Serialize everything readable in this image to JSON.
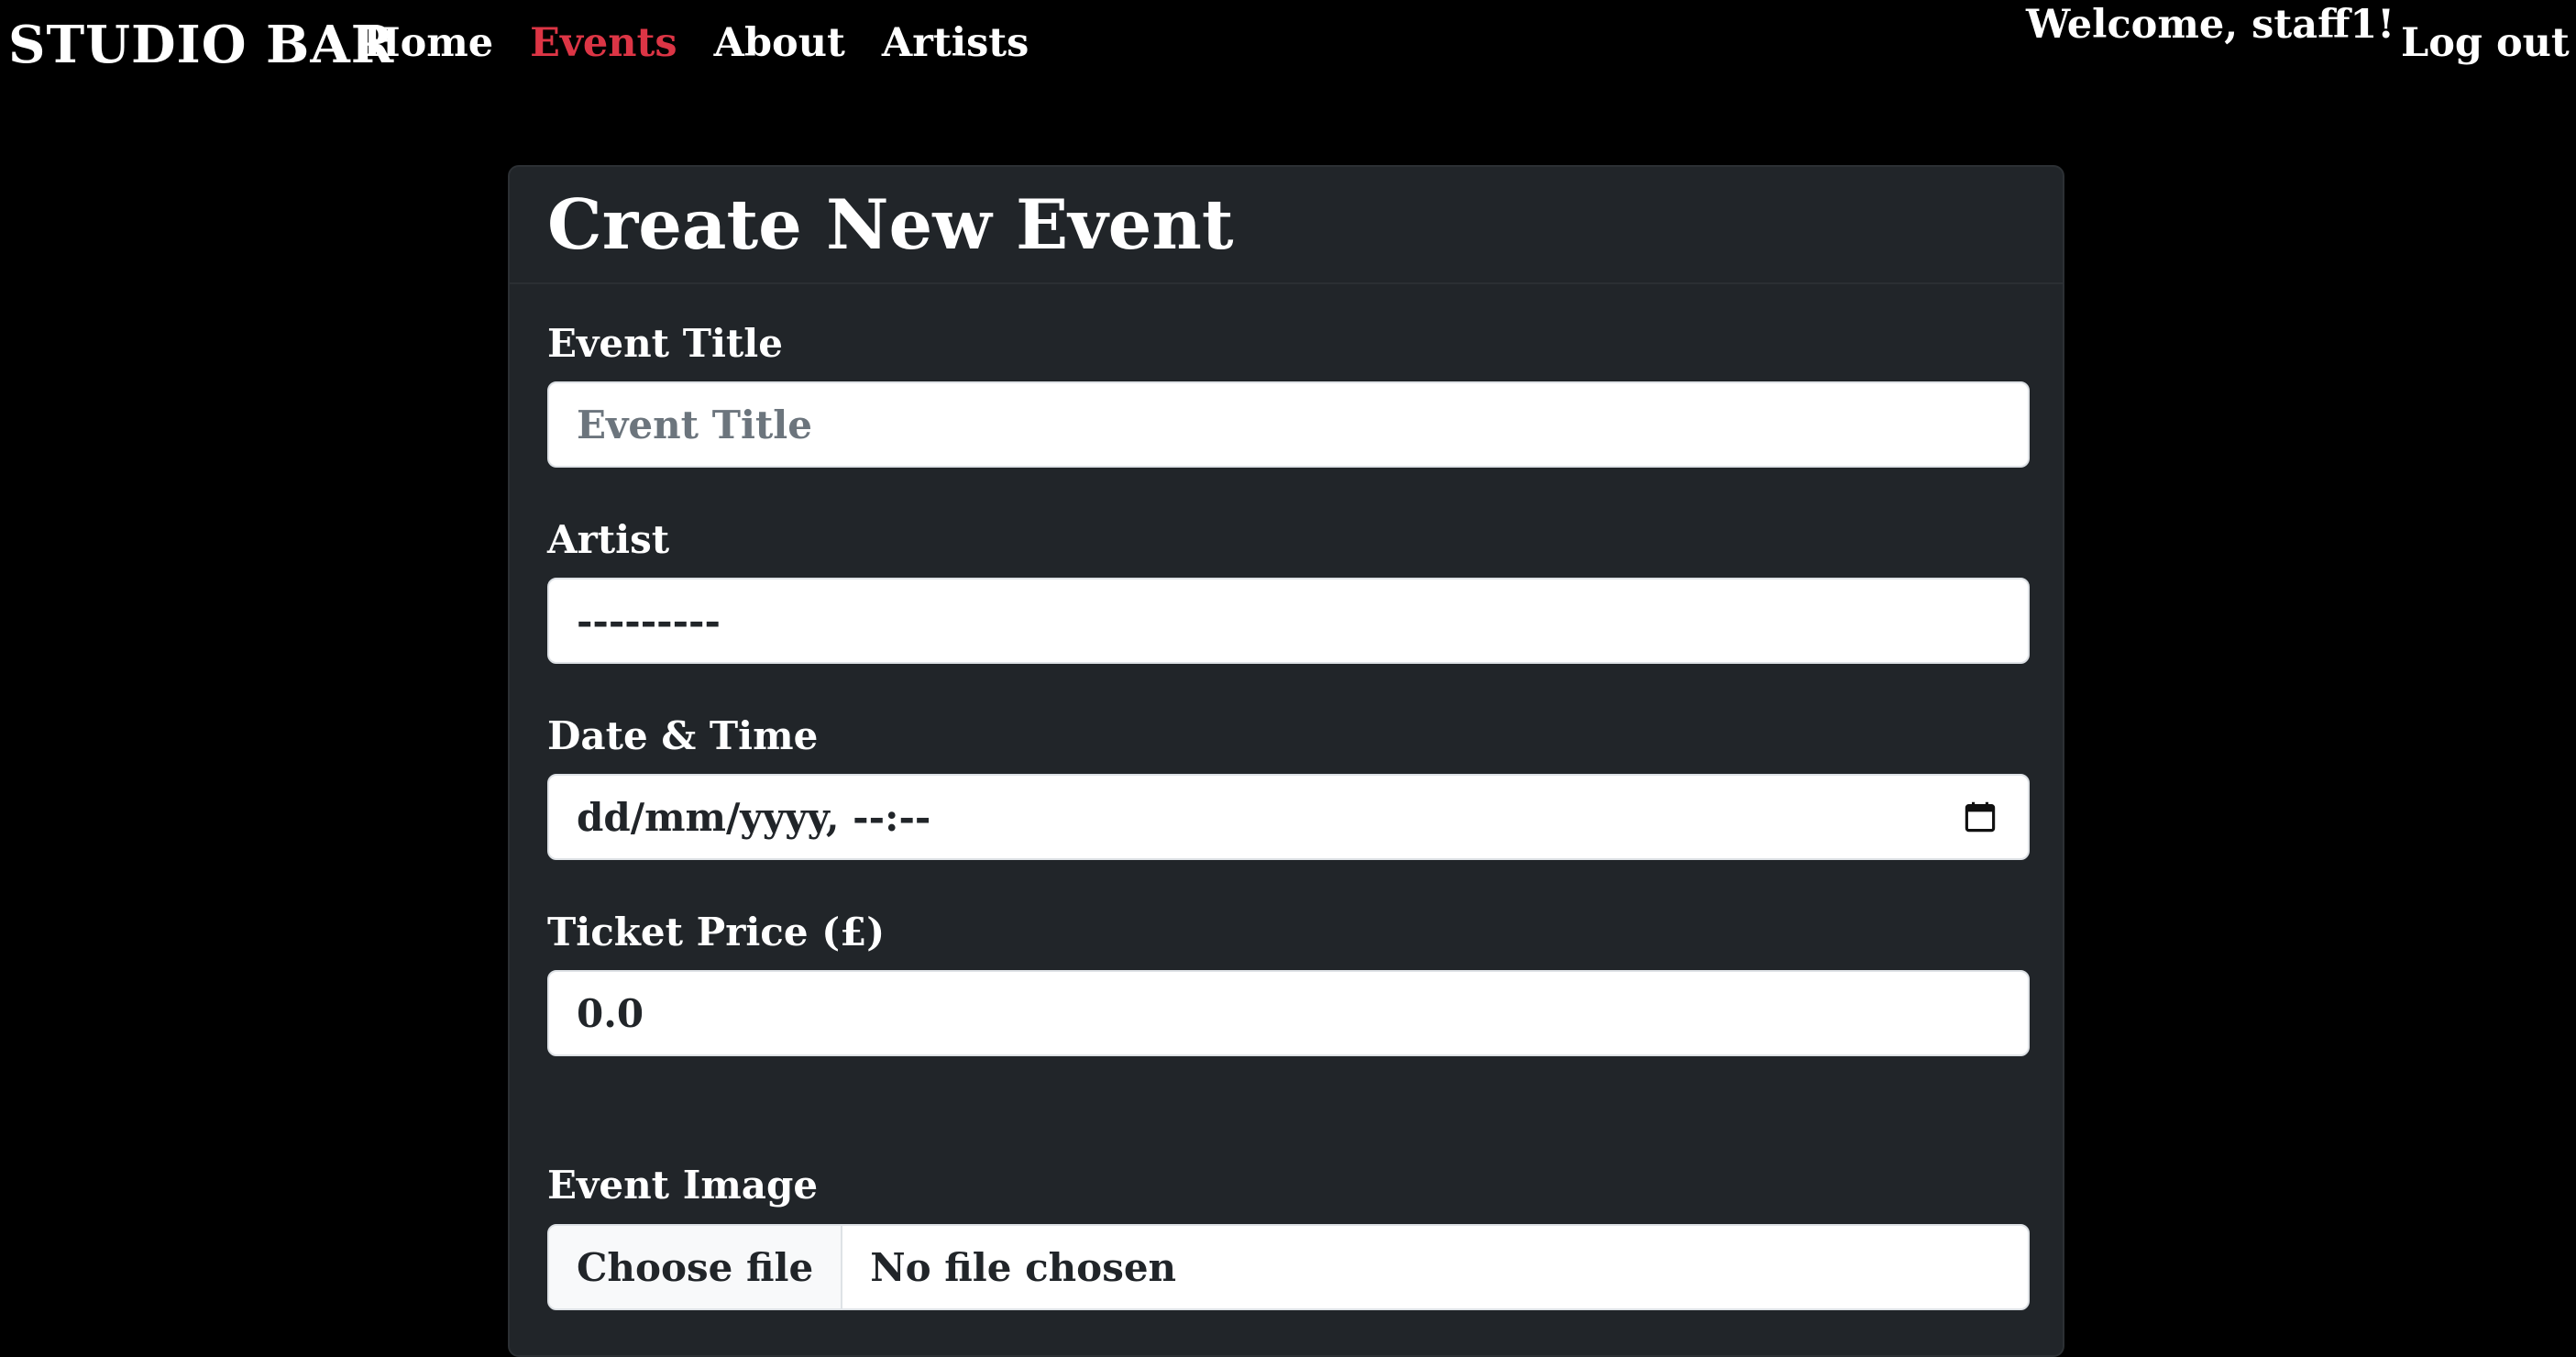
{
  "navbar": {
    "brand": "STUDIO BAR",
    "links": [
      {
        "label": "Home",
        "active": false
      },
      {
        "label": "Events",
        "active": true
      },
      {
        "label": "About",
        "active": false
      },
      {
        "label": "Artists",
        "active": false
      }
    ],
    "welcome": "Welcome, staff1!",
    "logout_label": "Log out",
    "accent_color": "#dc3545"
  },
  "form": {
    "title": "Create New Event",
    "event_title": {
      "label": "Event Title",
      "placeholder": "Event Title",
      "value": ""
    },
    "artist": {
      "label": "Artist",
      "value": "---------"
    },
    "datetime": {
      "label": "Date & Time",
      "value": "dd/mm/yyyy, --:--",
      "icon": "calendar-icon"
    },
    "ticket_price": {
      "label": "Ticket Price (£)",
      "value": "0.0"
    },
    "image": {
      "label": "Event Image",
      "button_label": "Choose file",
      "status": "No file chosen"
    }
  },
  "colors": {
    "page_background": "#000000",
    "card_background": "#212529",
    "input_background": "#ffffff"
  }
}
